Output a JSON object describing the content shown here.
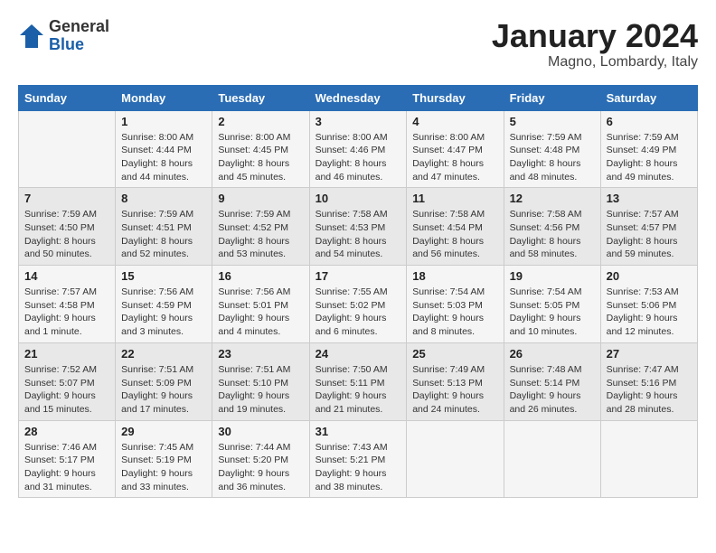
{
  "logo": {
    "general": "General",
    "blue": "Blue"
  },
  "title": "January 2024",
  "location": "Magno, Lombardy, Italy",
  "headers": [
    "Sunday",
    "Monday",
    "Tuesday",
    "Wednesday",
    "Thursday",
    "Friday",
    "Saturday"
  ],
  "weeks": [
    [
      {
        "day": "",
        "info": ""
      },
      {
        "day": "1",
        "info": "Sunrise: 8:00 AM\nSunset: 4:44 PM\nDaylight: 8 hours\nand 44 minutes."
      },
      {
        "day": "2",
        "info": "Sunrise: 8:00 AM\nSunset: 4:45 PM\nDaylight: 8 hours\nand 45 minutes."
      },
      {
        "day": "3",
        "info": "Sunrise: 8:00 AM\nSunset: 4:46 PM\nDaylight: 8 hours\nand 46 minutes."
      },
      {
        "day": "4",
        "info": "Sunrise: 8:00 AM\nSunset: 4:47 PM\nDaylight: 8 hours\nand 47 minutes."
      },
      {
        "day": "5",
        "info": "Sunrise: 7:59 AM\nSunset: 4:48 PM\nDaylight: 8 hours\nand 48 minutes."
      },
      {
        "day": "6",
        "info": "Sunrise: 7:59 AM\nSunset: 4:49 PM\nDaylight: 8 hours\nand 49 minutes."
      }
    ],
    [
      {
        "day": "7",
        "info": "Sunrise: 7:59 AM\nSunset: 4:50 PM\nDaylight: 8 hours\nand 50 minutes."
      },
      {
        "day": "8",
        "info": "Sunrise: 7:59 AM\nSunset: 4:51 PM\nDaylight: 8 hours\nand 52 minutes."
      },
      {
        "day": "9",
        "info": "Sunrise: 7:59 AM\nSunset: 4:52 PM\nDaylight: 8 hours\nand 53 minutes."
      },
      {
        "day": "10",
        "info": "Sunrise: 7:58 AM\nSunset: 4:53 PM\nDaylight: 8 hours\nand 54 minutes."
      },
      {
        "day": "11",
        "info": "Sunrise: 7:58 AM\nSunset: 4:54 PM\nDaylight: 8 hours\nand 56 minutes."
      },
      {
        "day": "12",
        "info": "Sunrise: 7:58 AM\nSunset: 4:56 PM\nDaylight: 8 hours\nand 58 minutes."
      },
      {
        "day": "13",
        "info": "Sunrise: 7:57 AM\nSunset: 4:57 PM\nDaylight: 8 hours\nand 59 minutes."
      }
    ],
    [
      {
        "day": "14",
        "info": "Sunrise: 7:57 AM\nSunset: 4:58 PM\nDaylight: 9 hours\nand 1 minute."
      },
      {
        "day": "15",
        "info": "Sunrise: 7:56 AM\nSunset: 4:59 PM\nDaylight: 9 hours\nand 3 minutes."
      },
      {
        "day": "16",
        "info": "Sunrise: 7:56 AM\nSunset: 5:01 PM\nDaylight: 9 hours\nand 4 minutes."
      },
      {
        "day": "17",
        "info": "Sunrise: 7:55 AM\nSunset: 5:02 PM\nDaylight: 9 hours\nand 6 minutes."
      },
      {
        "day": "18",
        "info": "Sunrise: 7:54 AM\nSunset: 5:03 PM\nDaylight: 9 hours\nand 8 minutes."
      },
      {
        "day": "19",
        "info": "Sunrise: 7:54 AM\nSunset: 5:05 PM\nDaylight: 9 hours\nand 10 minutes."
      },
      {
        "day": "20",
        "info": "Sunrise: 7:53 AM\nSunset: 5:06 PM\nDaylight: 9 hours\nand 12 minutes."
      }
    ],
    [
      {
        "day": "21",
        "info": "Sunrise: 7:52 AM\nSunset: 5:07 PM\nDaylight: 9 hours\nand 15 minutes."
      },
      {
        "day": "22",
        "info": "Sunrise: 7:51 AM\nSunset: 5:09 PM\nDaylight: 9 hours\nand 17 minutes."
      },
      {
        "day": "23",
        "info": "Sunrise: 7:51 AM\nSunset: 5:10 PM\nDaylight: 9 hours\nand 19 minutes."
      },
      {
        "day": "24",
        "info": "Sunrise: 7:50 AM\nSunset: 5:11 PM\nDaylight: 9 hours\nand 21 minutes."
      },
      {
        "day": "25",
        "info": "Sunrise: 7:49 AM\nSunset: 5:13 PM\nDaylight: 9 hours\nand 24 minutes."
      },
      {
        "day": "26",
        "info": "Sunrise: 7:48 AM\nSunset: 5:14 PM\nDaylight: 9 hours\nand 26 minutes."
      },
      {
        "day": "27",
        "info": "Sunrise: 7:47 AM\nSunset: 5:16 PM\nDaylight: 9 hours\nand 28 minutes."
      }
    ],
    [
      {
        "day": "28",
        "info": "Sunrise: 7:46 AM\nSunset: 5:17 PM\nDaylight: 9 hours\nand 31 minutes."
      },
      {
        "day": "29",
        "info": "Sunrise: 7:45 AM\nSunset: 5:19 PM\nDaylight: 9 hours\nand 33 minutes."
      },
      {
        "day": "30",
        "info": "Sunrise: 7:44 AM\nSunset: 5:20 PM\nDaylight: 9 hours\nand 36 minutes."
      },
      {
        "day": "31",
        "info": "Sunrise: 7:43 AM\nSunset: 5:21 PM\nDaylight: 9 hours\nand 38 minutes."
      },
      {
        "day": "",
        "info": ""
      },
      {
        "day": "",
        "info": ""
      },
      {
        "day": "",
        "info": ""
      }
    ]
  ]
}
